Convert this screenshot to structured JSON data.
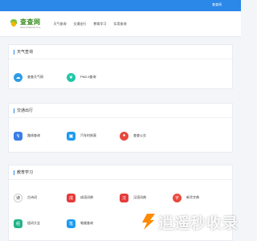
{
  "topbar": {
    "link": "查查网"
  },
  "logo": {
    "title": "查查网",
    "sub": "www.chachaw.com"
  },
  "nav": [
    "天气查询",
    "交通出行",
    "教育学习",
    "实用查询"
  ],
  "sections": [
    {
      "title": "天气查询",
      "items": [
        {
          "label": "查查天气网",
          "icon": "cloud-icon",
          "color": "#2f9be8"
        },
        {
          "label": "PM2.5查询",
          "icon": "leaf-icon",
          "color": "#1fc7a6"
        }
      ]
    },
    {
      "title": "交通出行",
      "items": [
        {
          "label": "路线查询",
          "icon": "route-icon",
          "color": "#3a7ee6"
        },
        {
          "label": "汽车时刻表",
          "icon": "car-icon",
          "color": "#1d9bf0"
        },
        {
          "label": "查查公交",
          "icon": "map-pin-icon",
          "color": "#e8473c"
        }
      ]
    },
    {
      "title": "教育学习",
      "items": [
        {
          "label": "古诗词",
          "icon": "poem-icon",
          "color": "#ffffff"
        },
        {
          "label": "成语词典",
          "icon": "idiom-icon",
          "color": "#e53a3a"
        },
        {
          "label": "汉语词典",
          "icon": "dictionary-icon",
          "color": "#e53a3a"
        },
        {
          "label": "新华字典",
          "icon": "character-icon",
          "color": "#e8473c"
        },
        {
          "label": "组词大全",
          "icon": "words-icon",
          "color": "#23b28a"
        },
        {
          "label": "笔顺查询",
          "icon": "stroke-icon",
          "color": "#1d9bf0"
        }
      ]
    }
  ],
  "watermark": "逍遥秒收录"
}
